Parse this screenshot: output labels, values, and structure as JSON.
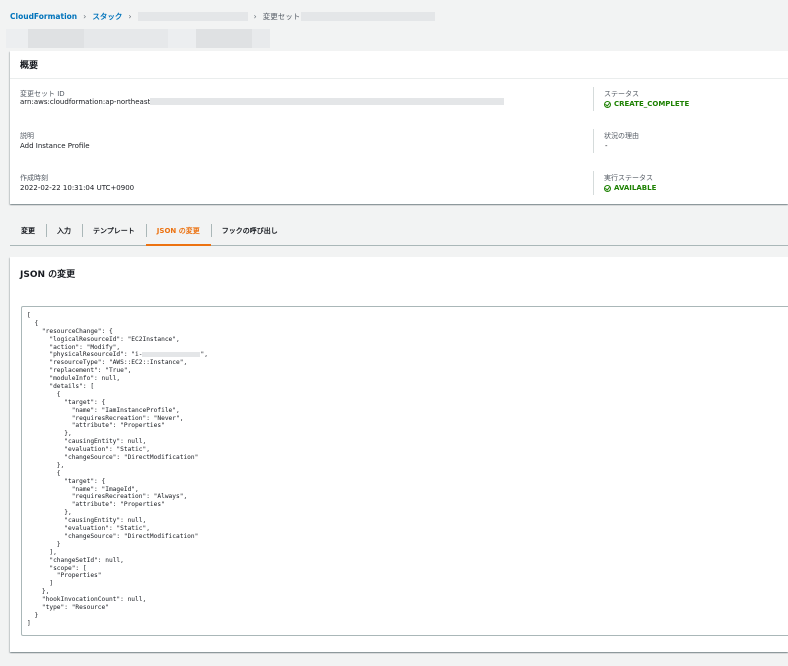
{
  "breadcrumb": {
    "service": "CloudFormation",
    "stacks": "スタック",
    "changeset": "変更セット"
  },
  "summary": {
    "title": "概要",
    "changeset_id_label": "変更セット ID",
    "changeset_id_value": "arn:aws:cloudformation:ap-northeast-1:",
    "description_label": "説明",
    "description_value": "Add Instance Profile",
    "created_label": "作成時刻",
    "created_value": "2022-02-22 10:31:04 UTC+0900",
    "status_label": "ステータス",
    "status_value": "CREATE_COMPLETE",
    "status_reason_label": "状況の理由",
    "status_reason_value": "-",
    "exec_status_label": "実行ステータス",
    "exec_status_value": "AVAILABLE"
  },
  "tabs": [
    {
      "label": "変更",
      "active": false
    },
    {
      "label": "入力",
      "active": false
    },
    {
      "label": "テンプレート",
      "active": false
    },
    {
      "label": "JSON の変更",
      "active": true
    },
    {
      "label": "フックの呼び出し",
      "active": false
    }
  ],
  "json_panel": {
    "title": "JSON の変更",
    "lines": [
      "[",
      "  {",
      "    \"resourceChange\": {",
      "      \"logicalResourceId\": \"EC2Instance\",",
      "      \"action\": \"Modify\",",
      "      \"physicalResourceId\": \"i-",
      "      \"resourceType\": \"AWS::EC2::Instance\",",
      "      \"replacement\": \"True\",",
      "      \"moduleInfo\": null,",
      "      \"details\": [",
      "        {",
      "          \"target\": {",
      "            \"name\": \"IamInstanceProfile\",",
      "            \"requiresRecreation\": \"Never\",",
      "            \"attribute\": \"Properties\"",
      "          },",
      "          \"causingEntity\": null,",
      "          \"evaluation\": \"Static\",",
      "          \"changeSource\": \"DirectModification\"",
      "        },",
      "        {",
      "          \"target\": {",
      "            \"name\": \"ImageId\",",
      "            \"requiresRecreation\": \"Always\",",
      "            \"attribute\": \"Properties\"",
      "          },",
      "          \"causingEntity\": null,",
      "          \"evaluation\": \"Static\",",
      "          \"changeSource\": \"DirectModification\"",
      "        }",
      "      ],",
      "      \"changeSetId\": null,",
      "      \"scope\": [",
      "        \"Properties\"",
      "      ]",
      "    },",
      "    \"hookInvocationCount\": null,",
      "    \"type\": \"Resource\"",
      "  }",
      "]"
    ],
    "physical_id_suffix": "\","
  }
}
